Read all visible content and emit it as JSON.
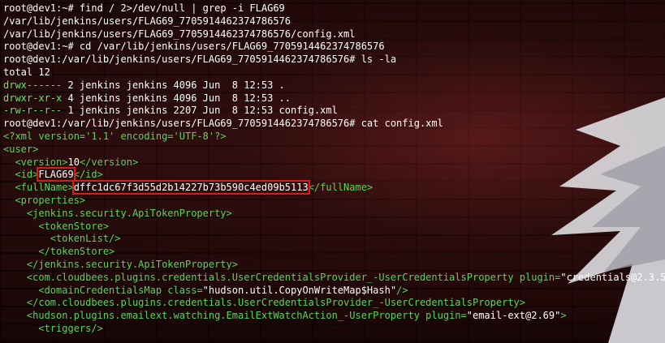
{
  "terminal": {
    "l1": {
      "prompt": "root@dev1:~# ",
      "cmd": "find / 2>/dev/null | grep -i FLAG69"
    },
    "l2": {
      "text": "/var/lib/jenkins/users/FLAG69_7705914462374786576"
    },
    "l3": {
      "text": "/var/lib/jenkins/users/FLAG69_7705914462374786576/config.xml"
    },
    "l4": {
      "prompt": "root@dev1:~# ",
      "cmd": "cd /var/lib/jenkins/users/FLAG69_7705914462374786576"
    },
    "l5": {
      "prompt": "root@dev1:/var/lib/jenkins/users/FLAG69_7705914462374786576# ",
      "cmd": "ls -la"
    },
    "l6": {
      "text": "total 12"
    },
    "l7": {
      "perm": "drwx------",
      "rest": " 2 jenkins jenkins 4096 Jun  8 12:53 ."
    },
    "l8": {
      "perm": "drwxr-xr-x",
      "rest": " 4 jenkins jenkins 4096 Jun  8 12:53 .."
    },
    "l9": {
      "perm": "-rw-r--r--",
      "rest": " 1 jenkins jenkins 2207 Jun  8 12:53 config.xml"
    },
    "l10": {
      "prompt": "root@dev1:/var/lib/jenkins/users/FLAG69_7705914462374786576# ",
      "cmd": "cat config.xml"
    },
    "l11": {
      "text": "<?xml version='1.1' encoding='UTF-8'?>"
    },
    "l12": {
      "text": "<user>"
    },
    "l13": {
      "open": "  <version>",
      "val": "10",
      "close": "</version>"
    },
    "l14": {
      "open": "  <id>",
      "val": "FLAG69",
      "close": "</id>"
    },
    "l15": {
      "open": "  <fullName>",
      "val": "dffc1dc67f3d55d2b14227b73b590c4ed09b5113",
      "close": "</fullName>"
    },
    "l16": {
      "text": "  <properties>"
    },
    "l17": {
      "text": "    <jenkins.security.ApiTokenProperty>"
    },
    "l18": {
      "text": "      <tokenStore>"
    },
    "l19": {
      "text": "        <tokenList/>"
    },
    "l20": {
      "text": "      </tokenStore>"
    },
    "l21": {
      "text": "    </jenkins.security.ApiTokenProperty>"
    },
    "l22": {
      "open": "    <com.cloudbees.plugins.credentials.UserCredentialsProvider_-UserCredentialsProperty plugin=",
      "val": "\"credentials@2.3.5\"",
      "close": ">"
    },
    "l23": {
      "open": "      <domainCredentialsMap class=",
      "val": "\"hudson.util.CopyOnWriteMap$Hash\"",
      "close": "/>"
    },
    "l24": {
      "text": "    </com.cloudbees.plugins.credentials.UserCredentialsProvider_-UserCredentialsProperty>"
    },
    "l25": {
      "open": "    <hudson.plugins.emailext.watching.EmailExtWatchAction_-UserProperty plugin=",
      "val": "\"email-ext@2.69\"",
      "close": ">"
    },
    "l26": {
      "text": "      <triggers/>"
    }
  },
  "colors": {
    "xml_tag": "#59d459",
    "highlight_box": "#e01818",
    "background": "#140707"
  }
}
